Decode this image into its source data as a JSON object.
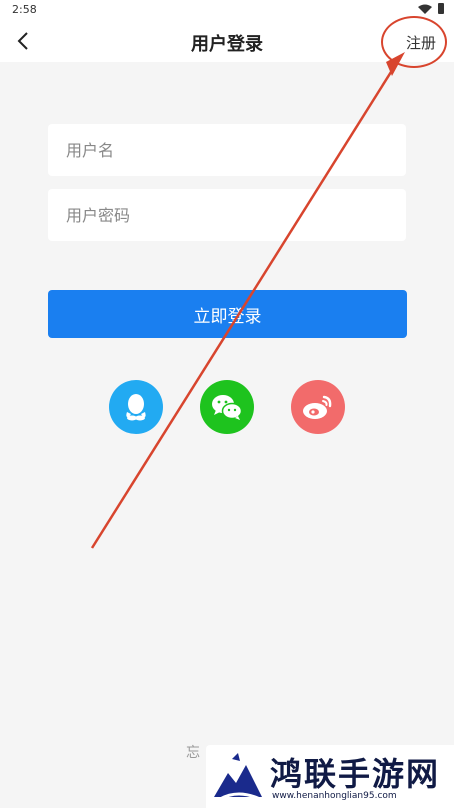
{
  "status_bar": {
    "time": "2:58"
  },
  "navbar": {
    "title": "用户登录",
    "register_label": "注册"
  },
  "form": {
    "username_placeholder": "用户名",
    "password_placeholder": "用户密码",
    "login_label": "立即登录"
  },
  "social_login": [
    {
      "icon": "qq-icon",
      "color": "#22aaf2"
    },
    {
      "icon": "wechat-icon",
      "color": "#1ec31e"
    },
    {
      "icon": "weibo-icon",
      "color": "#f26b6b"
    }
  ],
  "forgot_text": "忘",
  "watermark": {
    "title": "鸿联手游网",
    "url": "www.henanhonglian95.com"
  },
  "colors": {
    "primary": "#1a7ff0",
    "annotation": "#d8452e",
    "background": "#f5f5f5"
  }
}
